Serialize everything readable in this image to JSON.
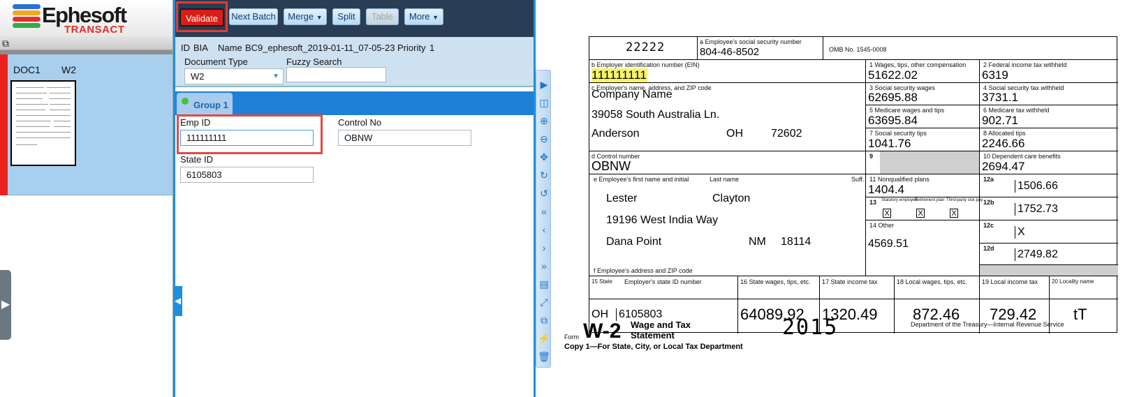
{
  "app": {
    "logo_main": "Ephesoft",
    "logo_sub": "TRANSACT"
  },
  "batch": {
    "doc_name": "DOC1",
    "doc_type": "W2"
  },
  "toolbar": {
    "validate": "Validate",
    "next_batch": "Next Batch",
    "merge": "Merge",
    "split": "Split",
    "table": "Table",
    "more": "More"
  },
  "info": {
    "id_label": "ID",
    "id_value": "BIA",
    "name_label": "Name",
    "name_value": "BC9_ephesoft_2019-01-11_07-05-23",
    "priority_label": "Priority",
    "priority_value": "1",
    "doc_type_label": "Document Type",
    "doc_type_value": "W2",
    "fuzzy_label": "Fuzzy Search",
    "fuzzy_value": ""
  },
  "group": {
    "tab": "Group 1"
  },
  "fields": {
    "emp_id_label": "Emp ID",
    "emp_id_value": "111111111",
    "control_label": "Control No",
    "control_value": "OBNW",
    "state_id_label": "State ID",
    "state_id_value": "6105803"
  },
  "w2": {
    "code": "22222",
    "a_label": "a  Employee's social security number",
    "ssn": "804-46-8502",
    "omb": "OMB No. 1545-0008",
    "b_label": "b  Employer identification number (EIN)",
    "ein": "111111111",
    "c_label": "c  Employer's name, address, and ZIP code",
    "employer": "Company Name",
    "emp_addr": "39058 South Australia Ln.",
    "emp_city": "Anderson",
    "emp_state": "OH",
    "emp_zip": "72602",
    "d_label": "d  Control number",
    "control": "OBNW",
    "e_label": "e  Employee's first name and initial",
    "last_label": "Last name",
    "suff_label": "Suff.",
    "first": "Lester",
    "last": "Clayton",
    "addr": "19196 West India Way",
    "city": "Dana Point",
    "state": "NM",
    "zip": "18114",
    "f_label": "f  Employee's address and ZIP code",
    "b1_label": "1  Wages, tips, other compensation",
    "b1": "51622.02",
    "b2_label": "2  Federal income tax withheld",
    "b2": "6319",
    "b3_label": "3  Social security wages",
    "b3": "62695.88",
    "b4_label": "4  Social security tax withheld",
    "b4": "3731.1",
    "b5_label": "5  Medicare wages and tips",
    "b5": "63695.84",
    "b6_label": "6  Medicare tax withheld",
    "b6": "902.71",
    "b7_label": "7  Social security tips",
    "b7": "1041.76",
    "b8_label": "8  Allocated tips",
    "b8": "2246.66",
    "b9_label": "9",
    "b10_label": "10  Dependent care benefits",
    "b10": "2694.47",
    "b11_label": "11  Nonqualified plans",
    "b11": "1404.4",
    "b12a_label": "12a",
    "b12a": "1506.66",
    "b12b_label": "12b",
    "b12b": "1752.73",
    "b12c_label": "12c",
    "b12c": "X",
    "b12d_label": "12d",
    "b12d": "2749.82",
    "b13_label": "13",
    "b13_1": "Statutory employee",
    "b13_2": "Retirement plan",
    "b13_3": "Third-party sick pay",
    "x": "X",
    "b14_label": "14  Other",
    "b14": "4569.51",
    "b15_label": "15  State",
    "b15_sub": "Employer's state ID number",
    "b15_state": "OH",
    "b15_id": "6105803",
    "b16_label": "16  State wages, tips, etc.",
    "b16": "64089.92",
    "b17_label": "17  State income tax",
    "b17": "1320.49",
    "b18_label": "18  Local wages, tips, etc.",
    "b18": "872.46",
    "b19_label": "19  Local income tax",
    "b19": "729.42",
    "b20_label": "20  Locality name",
    "b20": "tT",
    "form_word": "Form",
    "form_name": "W-2",
    "form_title1": "Wage and Tax",
    "form_title2": "Statement",
    "year": "2015",
    "dept": "Department of the Treasury—Internal Revenue Service",
    "copy": "Copy 1—For State, City, or Local Tax Department"
  }
}
